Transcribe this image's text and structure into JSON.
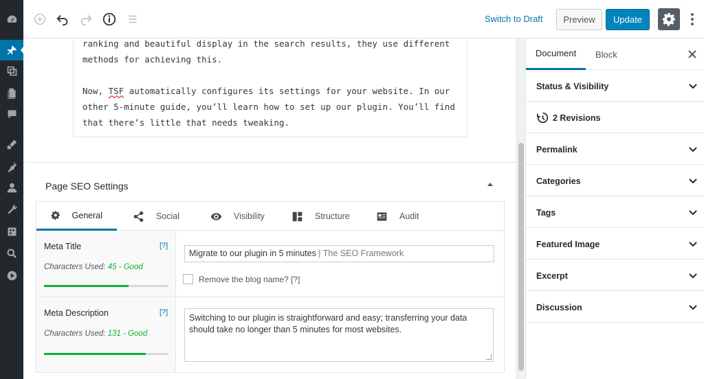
{
  "toolbar": {
    "switch_to_draft": "Switch to Draft",
    "preview": "Preview",
    "update": "Update"
  },
  "content": {
    "line1": "ranking and beautiful display in the search results, they use different",
    "line2": "methods for achieving this.",
    "para2_a": "Now, ",
    "para2_tsf": "TSF",
    "para2_b": " automatically configures its settings for your website. In our",
    "para2_c": "other 5-minute guide, you’ll learn how to set up our plugin. You’ll find",
    "para2_d": "that there’s little that needs tweaking."
  },
  "seo": {
    "title": "Page SEO Settings",
    "tabs": [
      {
        "label": "General",
        "icon": "gear-icon"
      },
      {
        "label": "Social",
        "icon": "share-icon"
      },
      {
        "label": "Visibility",
        "icon": "eye-icon"
      },
      {
        "label": "Structure",
        "icon": "structure-icon"
      },
      {
        "label": "Audit",
        "icon": "audit-icon"
      }
    ],
    "meta_title": {
      "label": "Meta Title",
      "help": "[?]",
      "counter_prefix": "Characters Used: ",
      "counter_value": "45 - Good",
      "fill_fraction": 0.68,
      "value": "Migrate to our plugin in 5 minutes",
      "suffix": " | The SEO Framework",
      "remove_blog_name": "Remove the blog name? [?]"
    },
    "meta_description": {
      "label": "Meta Description",
      "help": "[?]",
      "counter_prefix": "Characters Used: ",
      "counter_value": "131 - Good",
      "fill_fraction": 0.82,
      "value": "Switching to our plugin is straightforward and easy; transferring your data should take no longer than 5 minutes for most websites."
    }
  },
  "sidebar": {
    "tab_document": "Document",
    "tab_block": "Block",
    "sections": [
      "Status & Visibility",
      "2 Revisions",
      "Permalink",
      "Categories",
      "Tags",
      "Featured Image",
      "Excerpt",
      "Discussion"
    ]
  },
  "colors": {
    "accent": "#0073aa",
    "update_button": "#0085ba",
    "good": "#0eb130",
    "admin_bar": "#23282d"
  }
}
